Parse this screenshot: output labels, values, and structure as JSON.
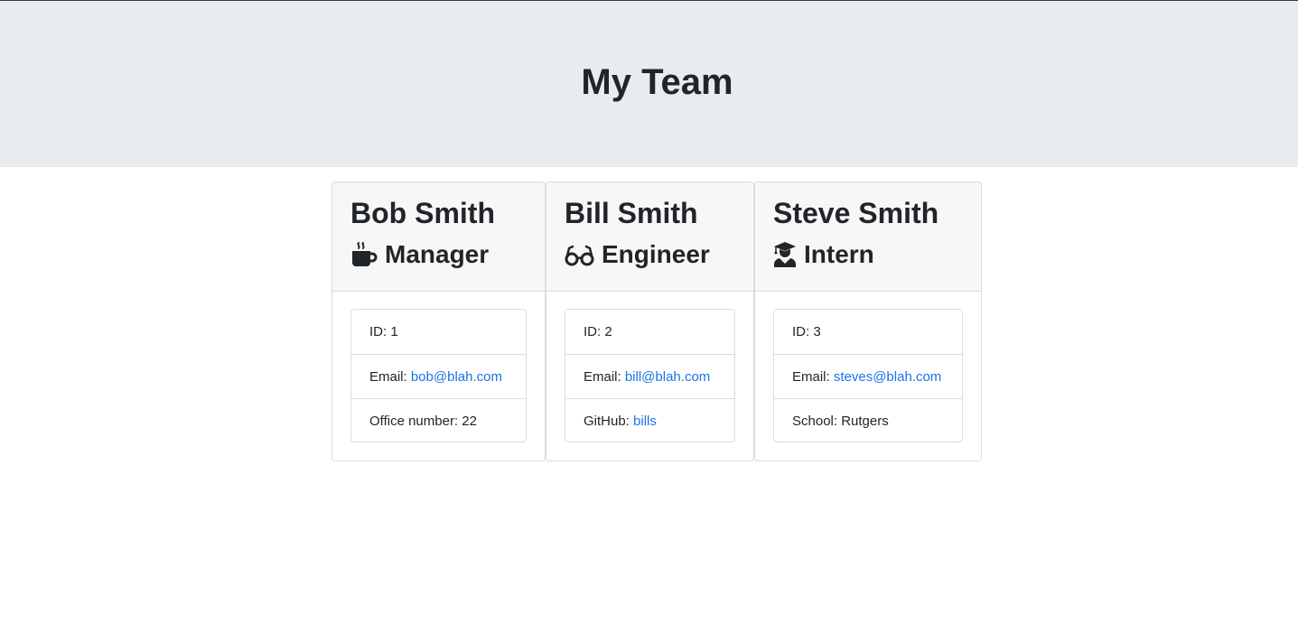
{
  "header": {
    "title": "My Team"
  },
  "colors": {
    "header_background": "#e9ecef",
    "link": "#1a73e8",
    "card_header_background": "#f7f7f7"
  },
  "team": [
    {
      "name": "Bob Smith",
      "role": "Manager",
      "icon": "mug-icon",
      "id_label": "ID: ",
      "id_value": "1",
      "email_label": "Email: ",
      "email": "bob@blah.com",
      "extra_label": "Office number: ",
      "extra_value": "22"
    },
    {
      "name": "Bill Smith",
      "role": "Engineer",
      "icon": "glasses-icon",
      "id_label": "ID: ",
      "id_value": "2",
      "email_label": "Email: ",
      "email": "bill@blah.com",
      "extra_label": "GitHub: ",
      "extra_value": "bills"
    },
    {
      "name": "Steve Smith",
      "role": "Intern",
      "icon": "user-graduate-icon",
      "id_label": "ID: ",
      "id_value": "3",
      "email_label": "Email: ",
      "email": "steves@blah.com",
      "extra_label": "School: ",
      "extra_value": "Rutgers"
    }
  ]
}
